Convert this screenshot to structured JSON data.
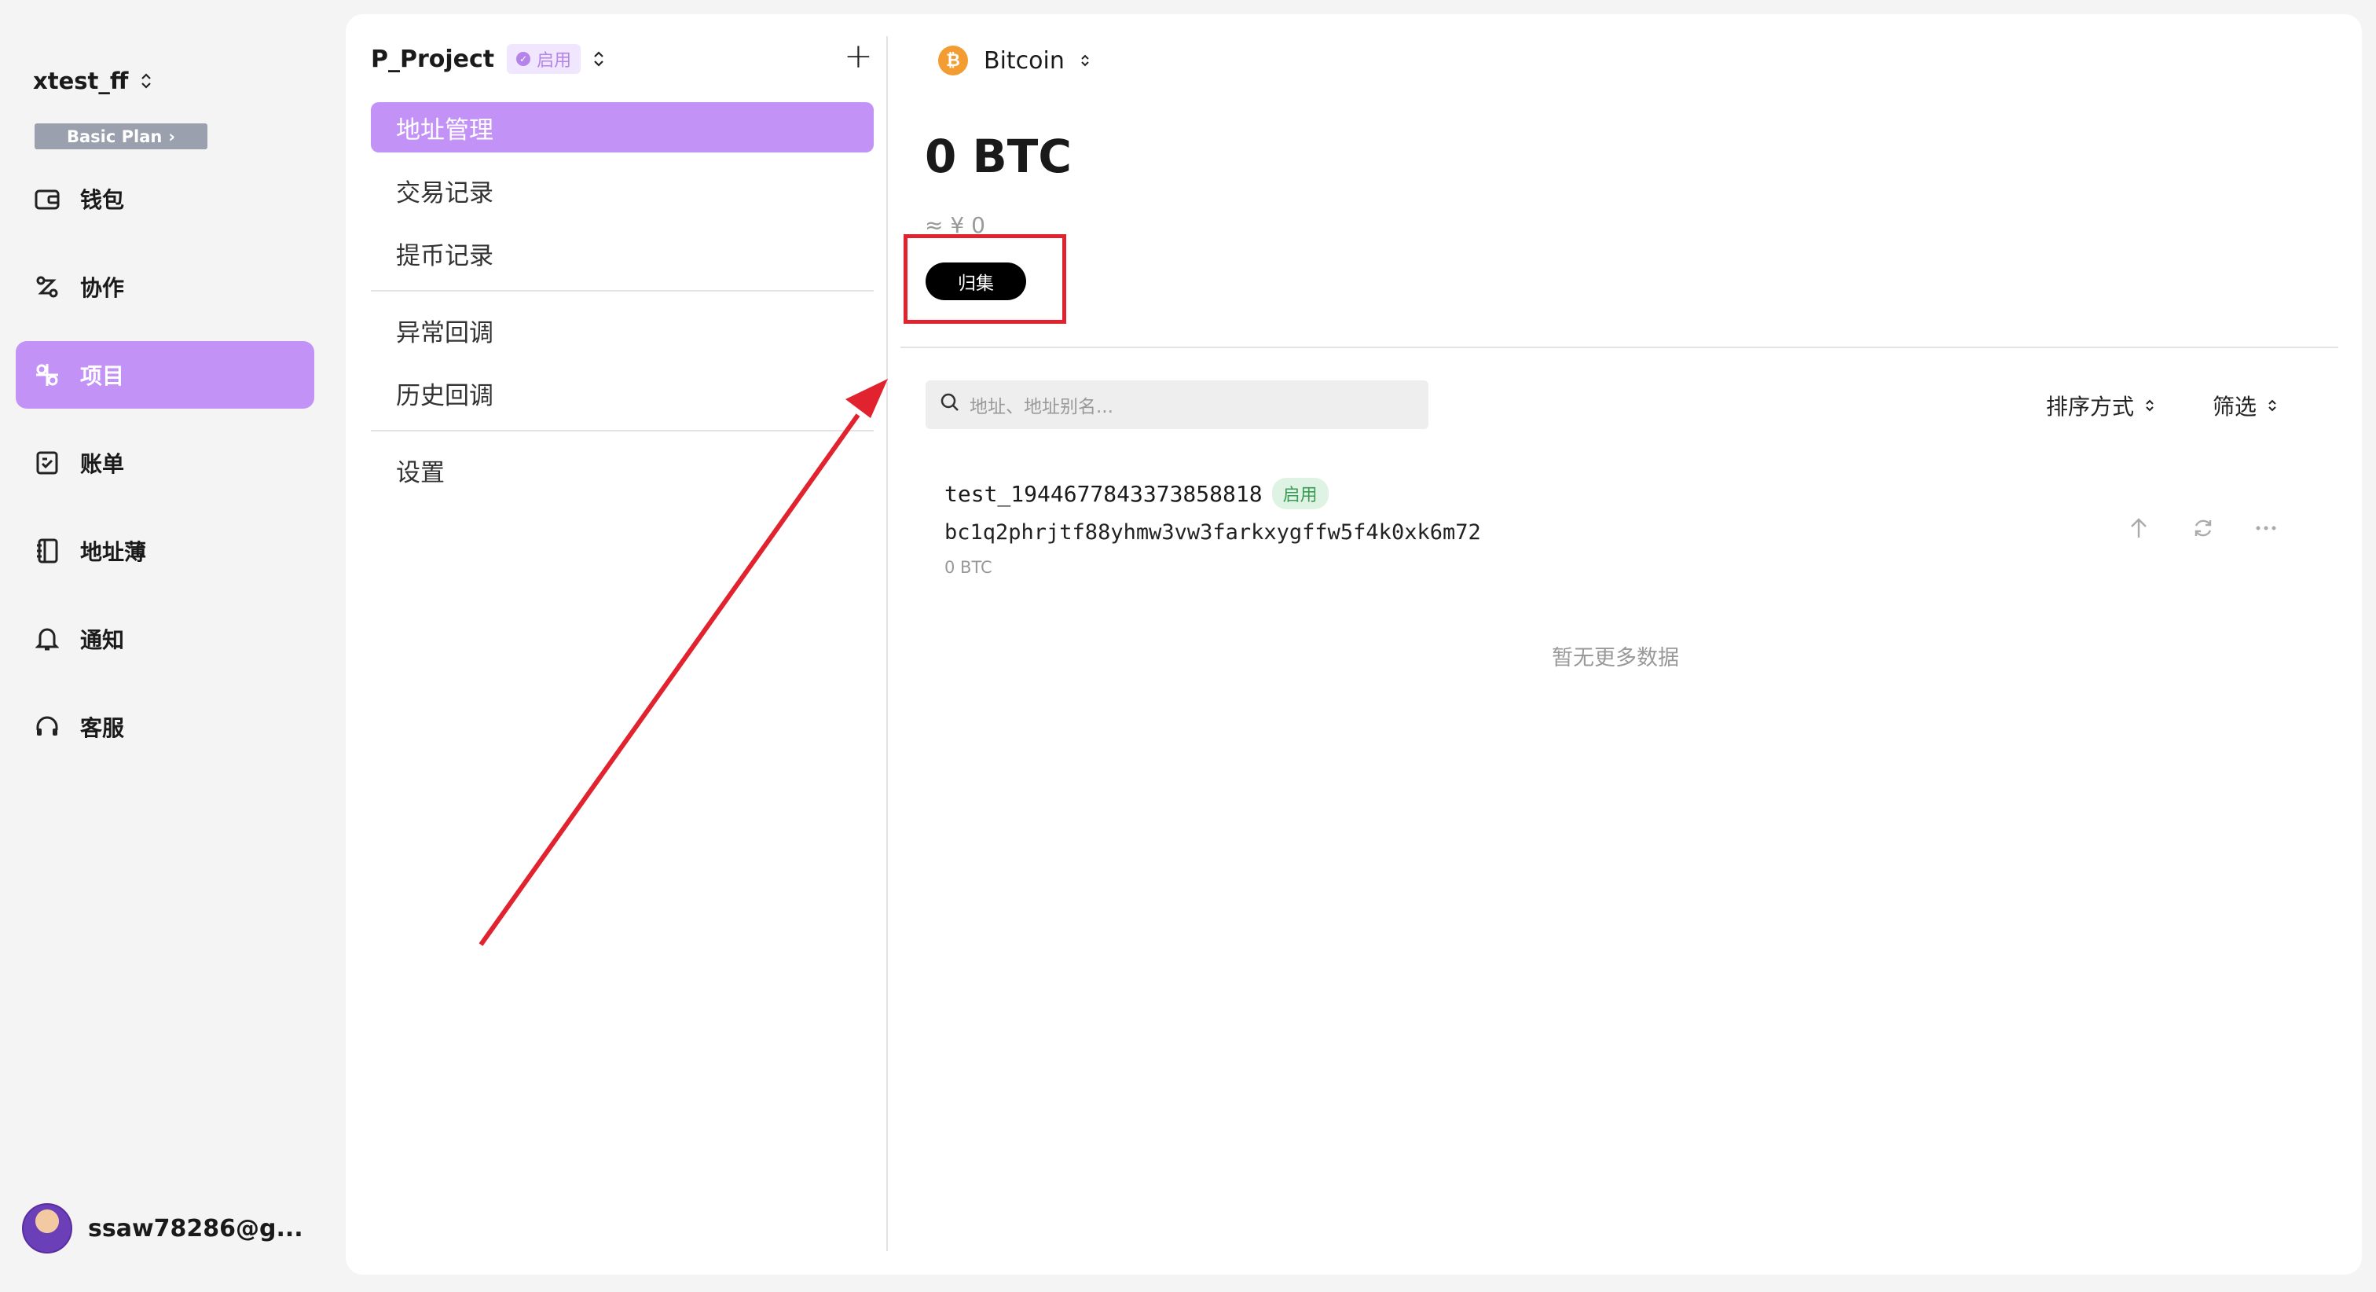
{
  "sidebar": {
    "workspace_name": "xtest_ff",
    "plan_label": "Basic Plan",
    "items": [
      {
        "label": "钱包",
        "icon": "wallet-icon"
      },
      {
        "label": "协作",
        "icon": "collaboration-icon"
      },
      {
        "label": "项目",
        "icon": "project-icon",
        "active": true
      },
      {
        "label": "账单",
        "icon": "bill-icon"
      },
      {
        "label": "地址薄",
        "icon": "address-book-icon"
      },
      {
        "label": "通知",
        "icon": "bell-icon"
      },
      {
        "label": "客服",
        "icon": "headset-icon"
      }
    ],
    "user": "ssaw78286@g..."
  },
  "project": {
    "name": "P_Project",
    "status": "启用",
    "menu": [
      "地址管理",
      "交易记录",
      "提币记录",
      "异常回调",
      "历史回调",
      "设置"
    ]
  },
  "coin": {
    "name": "Bitcoin",
    "balance": "0 BTC",
    "fiat": "≈ ¥ 0",
    "collect_label": "归集"
  },
  "toolbar": {
    "search_placeholder": "地址、地址别名...",
    "sort_label": "排序方式",
    "filter_label": "筛选"
  },
  "addresses": [
    {
      "name": "test_1944677843373858818",
      "status": "启用",
      "address": "bc1q2phrjtf88yhmw3vw3farkxygffw5f4k0xk6m72",
      "balance": "0 BTC"
    }
  ],
  "empty_more": "暂无更多数据",
  "colors": {
    "accent": "#c292f6",
    "annotation": "#e1232f",
    "btc": "#f39c31",
    "success": "#3a9a55"
  }
}
